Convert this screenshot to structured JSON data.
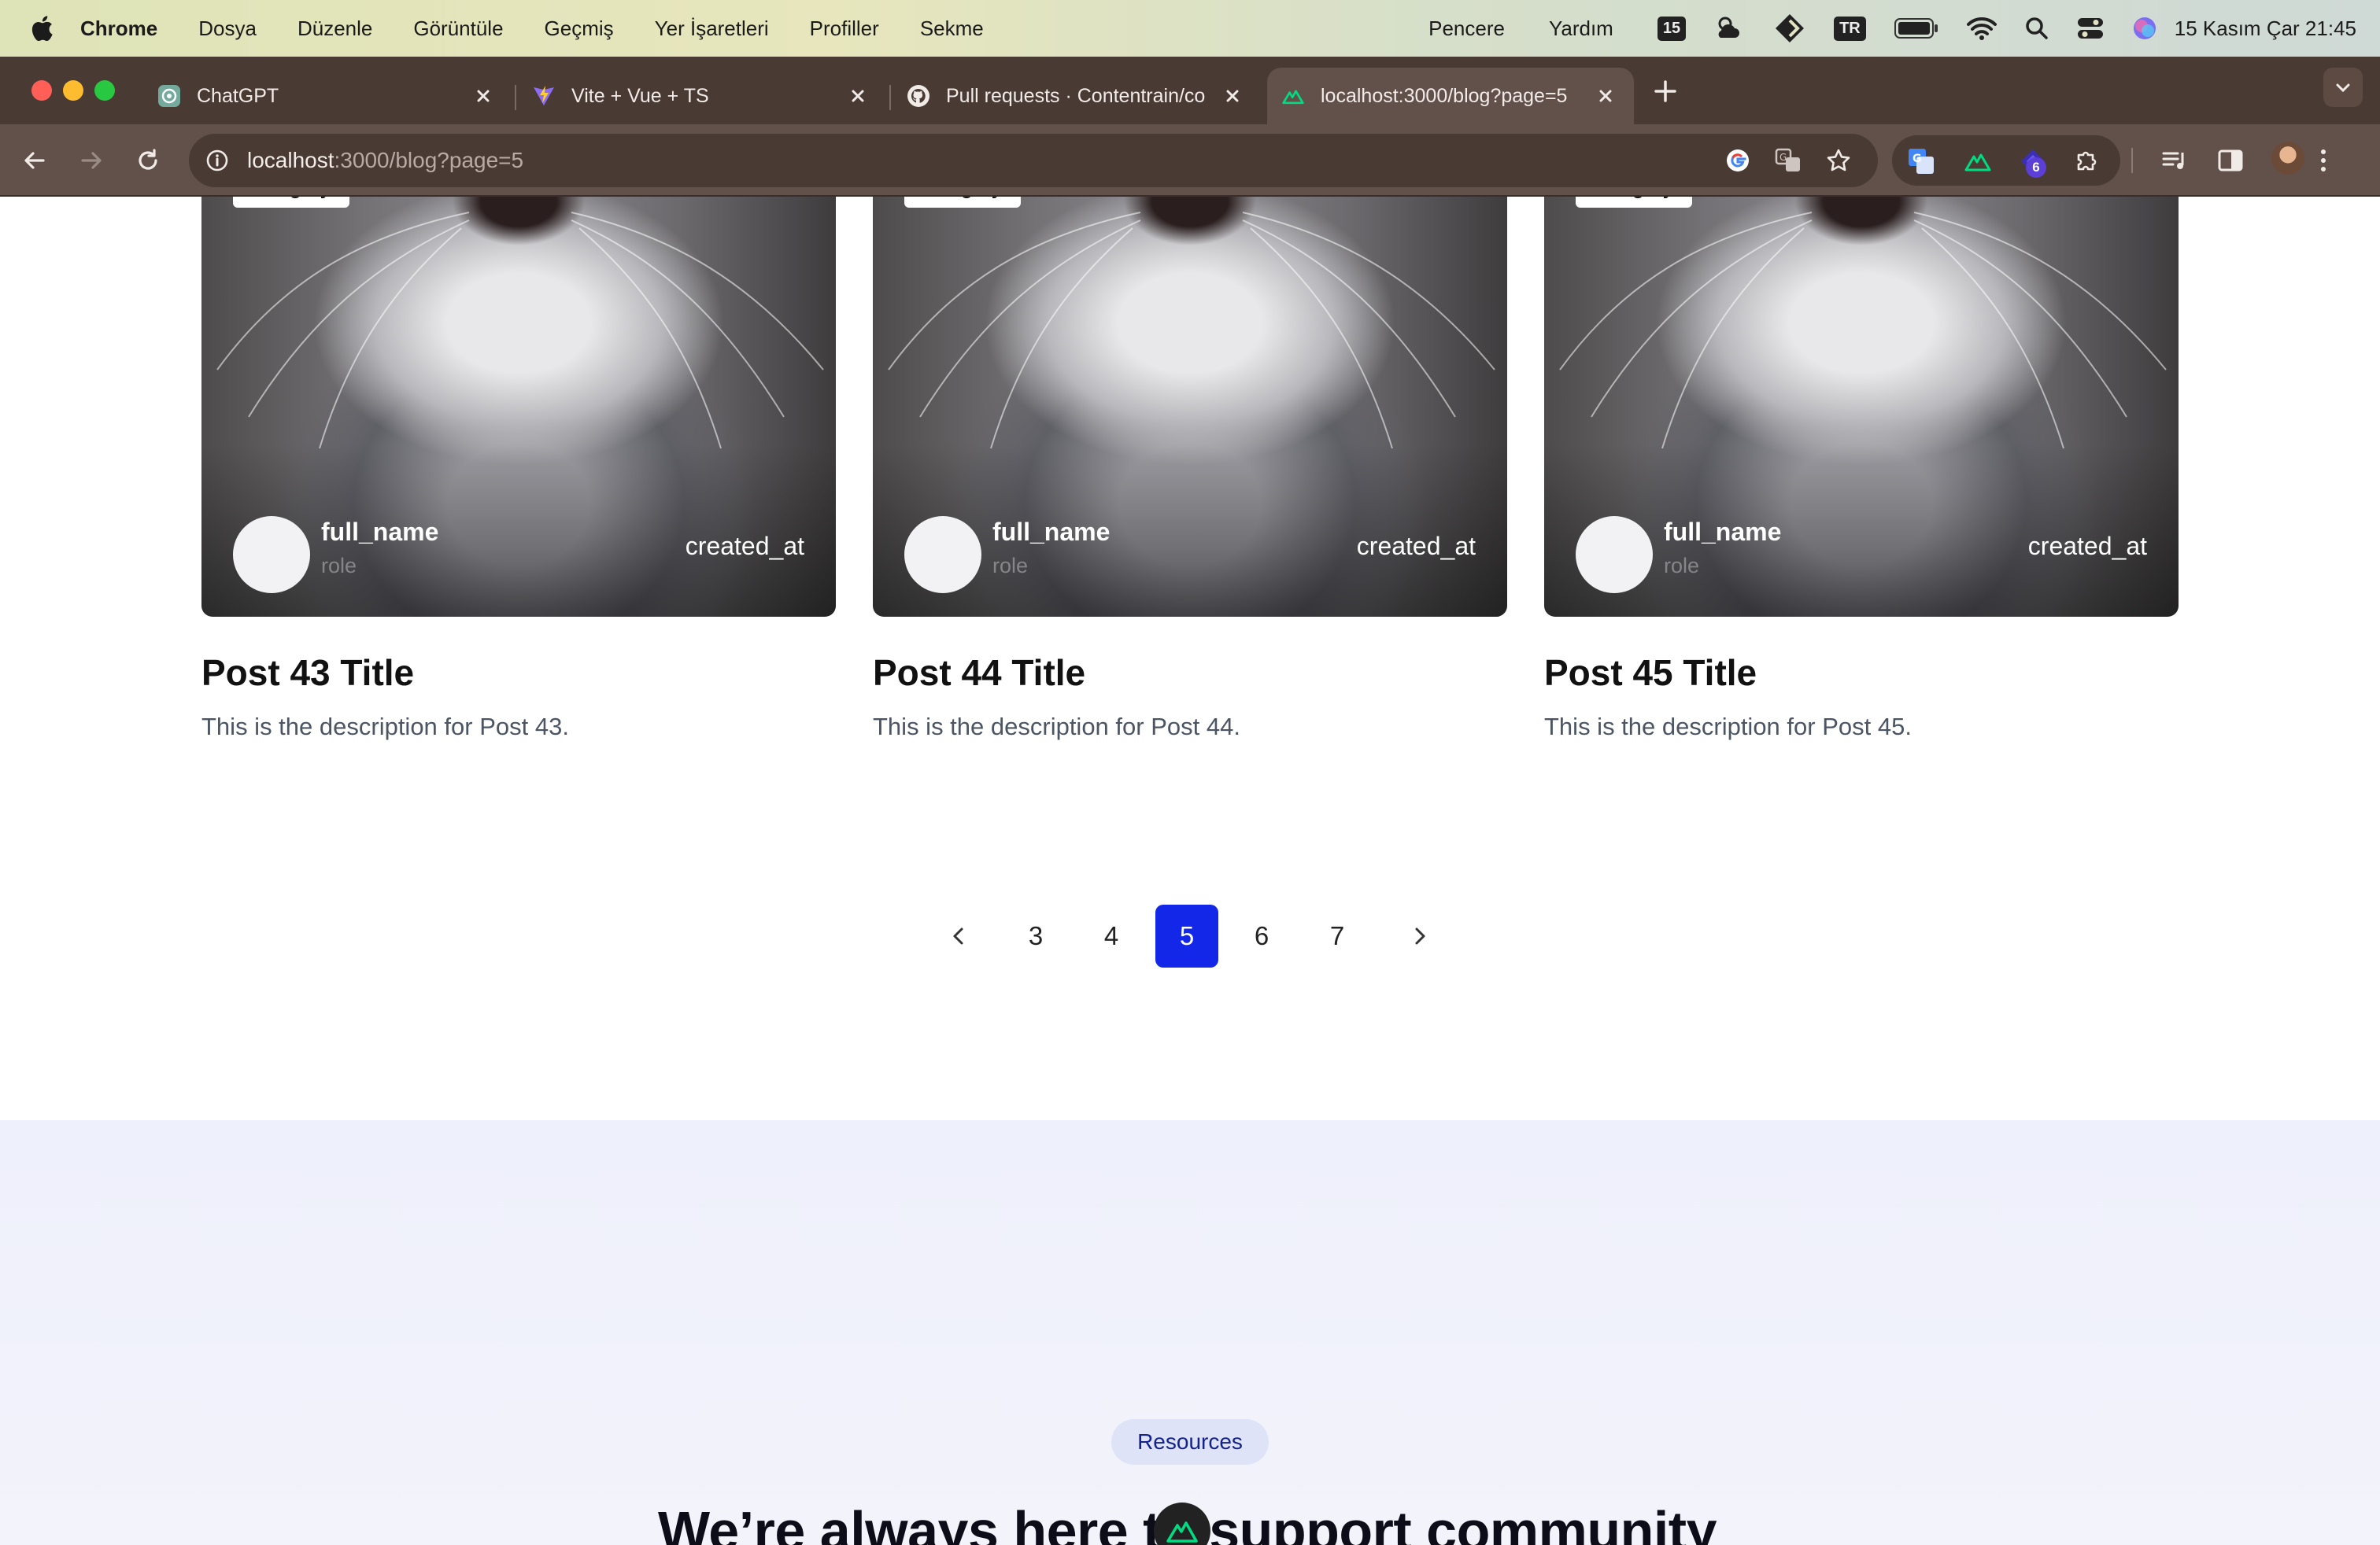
{
  "menubar": {
    "app": "Chrome",
    "items": [
      "Dosya",
      "Düzenle",
      "Görüntüle",
      "Geçmiş",
      "Yer İşaretleri",
      "Profiller",
      "Sekme"
    ],
    "right_items": [
      "Pencere",
      "Yardım"
    ],
    "status": {
      "calendar_badge": "15",
      "keyboard_badge": "TR"
    },
    "clock": "15 Kasım Çar 21:45"
  },
  "tabs": [
    {
      "title": "ChatGPT",
      "icon": "openai-icon"
    },
    {
      "title": "Vite + Vue + TS",
      "icon": "vite-icon"
    },
    {
      "title": "Pull requests · Contentrain/co",
      "icon": "github-icon"
    },
    {
      "title": "localhost:3000/blog?page=5",
      "icon": "nuxt-icon",
      "active": true
    }
  ],
  "address": {
    "host": "localhost",
    "rest": ":3000/blog?page=5"
  },
  "extensions": {
    "badge": "6"
  },
  "posts": [
    {
      "category": "category",
      "full_name": "full_name",
      "role": "role",
      "created_at": "created_at",
      "title": "Post 43 Title",
      "description": "This is the description for Post 43."
    },
    {
      "category": "category",
      "full_name": "full_name",
      "role": "role",
      "created_at": "created_at",
      "title": "Post 44 Title",
      "description": "This is the description for Post 44."
    },
    {
      "category": "category",
      "full_name": "full_name",
      "role": "role",
      "created_at": "created_at",
      "title": "Post 45 Title",
      "description": "This is the description for Post 45."
    }
  ],
  "pagination": {
    "pages": [
      "3",
      "4",
      "5",
      "6",
      "7"
    ],
    "current": "5"
  },
  "resources": {
    "pill": "Resources",
    "headline": "We’re always here to support community"
  },
  "colors": {
    "accent": "#1227e8",
    "tab_bar": "#4a3a34",
    "toolbar": "#62504a",
    "section_bg": "#eef0fb"
  }
}
